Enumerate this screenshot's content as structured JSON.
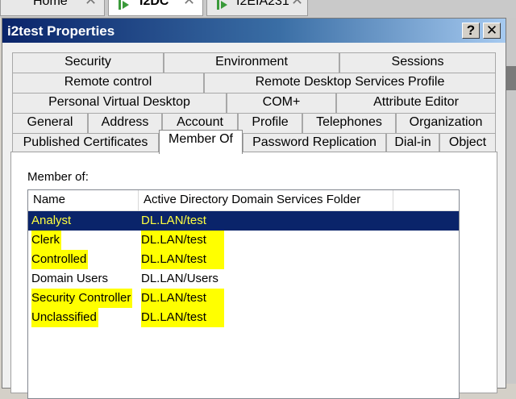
{
  "host_tabs": [
    {
      "label": "Home",
      "active": false
    },
    {
      "label": "I2DC",
      "active": true
    },
    {
      "label": "I2EIA231",
      "active": false
    }
  ],
  "dialog": {
    "title": "i2test Properties",
    "help_label": "?",
    "close_label": "✕"
  },
  "tab_rows": [
    [
      "Security",
      "Environment",
      "Sessions"
    ],
    [
      "Remote control",
      "Remote Desktop Services Profile"
    ],
    [
      "Personal Virtual Desktop",
      "COM+",
      "Attribute Editor"
    ],
    [
      "General",
      "Address",
      "Account",
      "Profile",
      "Telephones",
      "Organization"
    ],
    [
      "Published Certificates",
      "Member Of",
      "Password Replication",
      "Dial-in",
      "Object"
    ]
  ],
  "selected_tab": "Member Of",
  "member_of": {
    "label": "Member of:",
    "columns": [
      "Name",
      "Active Directory Domain Services Folder"
    ],
    "rows": [
      {
        "name": "Analyst",
        "folder": "DL.LAN/test",
        "selected": true,
        "highlighted": true
      },
      {
        "name": "Clerk",
        "folder": "DL.LAN/test",
        "selected": false,
        "highlighted": true
      },
      {
        "name": "Controlled",
        "folder": "DL.LAN/test",
        "selected": false,
        "highlighted": true
      },
      {
        "name": "Domain Users",
        "folder": "DL.LAN/Users",
        "selected": false,
        "highlighted": false
      },
      {
        "name": "Security Controller",
        "folder": "DL.LAN/test",
        "selected": false,
        "highlighted": true
      },
      {
        "name": "Unclassified",
        "folder": "DL.LAN/test",
        "selected": false,
        "highlighted": true
      }
    ]
  },
  "colors": {
    "titlebar": "#0a246a",
    "selection": "#0a246a",
    "highlighter": "#ffff00"
  }
}
